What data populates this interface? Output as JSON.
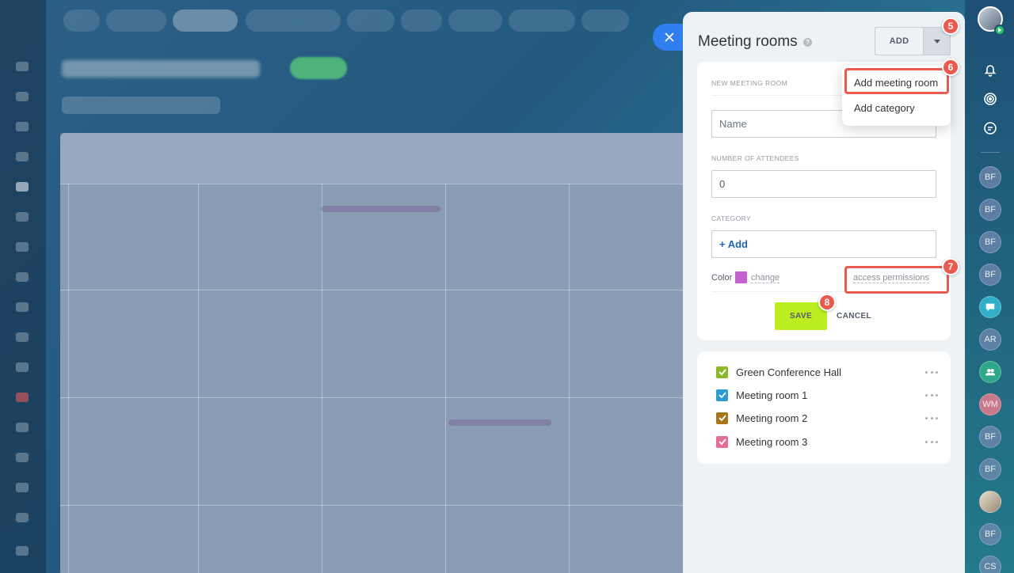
{
  "panel": {
    "title": "Meeting rooms",
    "help_icon": "?",
    "add_button_label": "ADD"
  },
  "dropdown": {
    "items": [
      "Add meeting room",
      "Add category"
    ]
  },
  "form": {
    "section_new_room": "NEW MEETING ROOM",
    "name_placeholder": "Name",
    "section_attendees": "NUMBER OF ATTENDEES",
    "attendees_value": "0",
    "section_category": "CATEGORY",
    "category_add": "+ Add",
    "color_label": "Color",
    "color_value": "#c45fd0",
    "change_label": "change",
    "access_label": "access permissions",
    "save_label": "SAVE",
    "cancel_label": "CANCEL"
  },
  "rooms": [
    {
      "name": "Green Conference Hall",
      "color": "#8cb82b"
    },
    {
      "name": "Meeting room 1",
      "color": "#2b9bd2"
    },
    {
      "name": "Meeting room 2",
      "color": "#a8761a"
    },
    {
      "name": "Meeting room 3",
      "color": "#e36e9a"
    }
  ],
  "annotations": [
    "5",
    "6",
    "7",
    "8"
  ],
  "right_sidebar": {
    "avatars": [
      "BF",
      "BF",
      "BF",
      "BF",
      "AR",
      "WM",
      "BF",
      "BF",
      "BF",
      "CS"
    ]
  },
  "icons": {
    "close": "close-icon",
    "dropdown": "chevron-down-icon",
    "bell": "bell-icon",
    "pulse": "pulse-icon",
    "chat": "chat-icon"
  }
}
